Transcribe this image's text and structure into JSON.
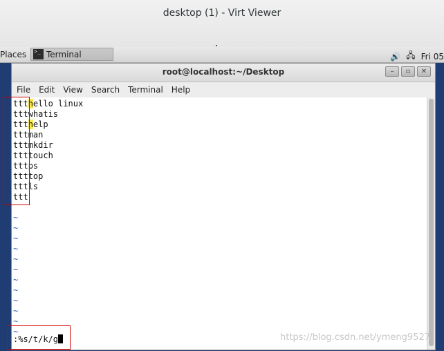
{
  "viewer": {
    "title": "desktop (1) - Virt Viewer"
  },
  "panel": {
    "places": "Places",
    "task_label": "Terminal",
    "task_icon_text": ">_",
    "volume_icon": "🔊",
    "network_icon": "🖧",
    "clock": "Fri 05"
  },
  "terminal": {
    "title": "root@localhost:~/Desktop",
    "buttons": {
      "minimize": "–",
      "maximize": "▫",
      "close": "✕"
    },
    "menu": [
      "File",
      "Edit",
      "View",
      "Search",
      "Terminal",
      "Help"
    ],
    "lines": [
      {
        "a": "ttt",
        "h": "h",
        "b": "ello linux"
      },
      {
        "a": "ttt",
        "h": "",
        "b": "whatis"
      },
      {
        "a": "ttt",
        "h": "h",
        "b": "elp"
      },
      {
        "a": "ttt",
        "h": "",
        "b": "man"
      },
      {
        "a": "ttt",
        "h": "",
        "b": "mkdir"
      },
      {
        "a": "ttt",
        "h": "",
        "b": "touch"
      },
      {
        "a": "ttt",
        "h": "",
        "b": "ps"
      },
      {
        "a": "ttt",
        "h": "",
        "b": "top"
      },
      {
        "a": "ttt",
        "h": "",
        "b": "ls"
      },
      {
        "a": "ttt",
        "h": "",
        "b": ""
      }
    ],
    "tilde": "~",
    "tilde_count": 12,
    "command": ":%s/t/k/g"
  },
  "watermark": "https://blog.csdn.net/ymeng9527",
  "colors": {
    "highlight": "#fce94f",
    "annotation": "#d40000",
    "tilde": "#2a5fb8"
  }
}
